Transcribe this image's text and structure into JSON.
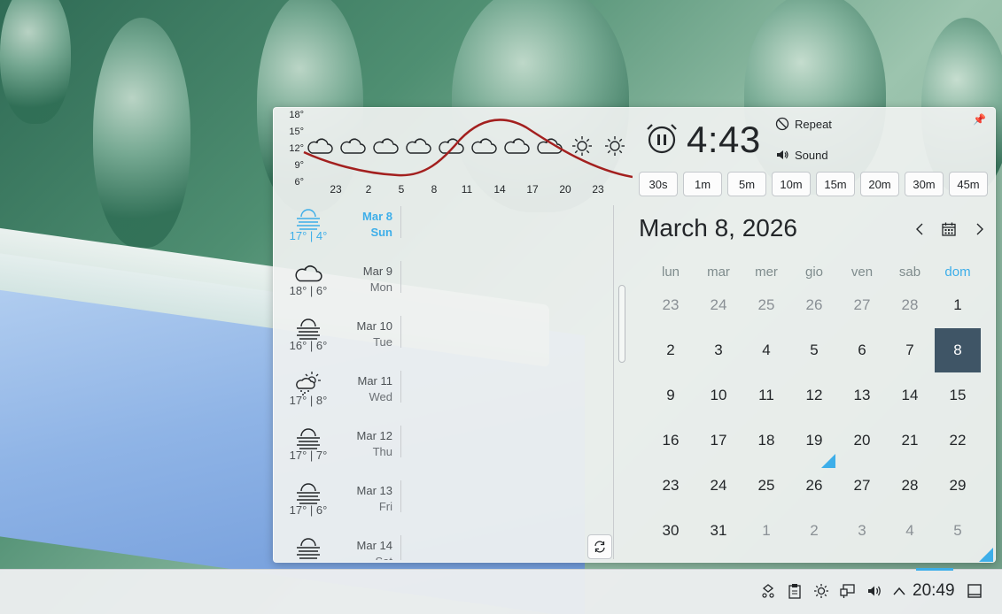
{
  "hourly": {
    "y_ticks": [
      "18°",
      "15°",
      "12°",
      "9°",
      "6°"
    ],
    "hours": [
      "23",
      "2",
      "5",
      "8",
      "11",
      "14",
      "17",
      "20",
      "23"
    ],
    "icons": [
      "cloudy-icon",
      "cloudy-icon",
      "cloudy-icon",
      "cloudy-icon",
      "cloudy-icon",
      "cloudy-icon",
      "cloudy-icon",
      "cloudy-icon",
      "sun-icon",
      "sun-icon"
    ],
    "temperature_curve_color": "#a3201f"
  },
  "timer": {
    "time": "4:43",
    "repeat_label": "Repeat",
    "sound_label": "Sound",
    "presets": [
      "30s",
      "1m",
      "5m",
      "10m",
      "15m",
      "20m",
      "30m",
      "45m"
    ]
  },
  "daily": [
    {
      "date": "Mar 8",
      "dow": "Sun",
      "temps": "17° | 4°",
      "icon": "fog-icon",
      "today": true
    },
    {
      "date": "Mar 9",
      "dow": "Mon",
      "temps": "18° | 6°",
      "icon": "cloudy-icon",
      "today": false
    },
    {
      "date": "Mar 10",
      "dow": "Tue",
      "temps": "16° | 6°",
      "icon": "fog-icon",
      "today": false
    },
    {
      "date": "Mar 11",
      "dow": "Wed",
      "temps": "17° | 8°",
      "icon": "sun-rain-icon",
      "today": false
    },
    {
      "date": "Mar 12",
      "dow": "Thu",
      "temps": "17° | 7°",
      "icon": "fog-icon",
      "today": false
    },
    {
      "date": "Mar 13",
      "dow": "Fri",
      "temps": "17° | 6°",
      "icon": "fog-icon",
      "today": false
    },
    {
      "date": "Mar 14",
      "dow": "Sat",
      "temps": "",
      "icon": "fog-icon",
      "today": false
    }
  ],
  "calendar": {
    "title": "March 8, 2026",
    "weekdays": [
      "lun",
      "mar",
      "mer",
      "gio",
      "ven",
      "sab",
      "dom"
    ],
    "weeks": [
      [
        "23",
        "24",
        "25",
        "26",
        "27",
        "28",
        "1"
      ],
      [
        "2",
        "3",
        "4",
        "5",
        "6",
        "7",
        "8"
      ],
      [
        "9",
        "10",
        "11",
        "12",
        "13",
        "14",
        "15"
      ],
      [
        "16",
        "17",
        "18",
        "19",
        "20",
        "21",
        "22"
      ],
      [
        "23",
        "24",
        "25",
        "26",
        "27",
        "28",
        "29"
      ],
      [
        "30",
        "31",
        "1",
        "2",
        "3",
        "4",
        "5"
      ]
    ],
    "accent": "#3daee9",
    "today_bg": "#3f5566"
  },
  "taskbar": {
    "clock": "20:49",
    "tray_icons": [
      "connect-icon",
      "clipboard-icon",
      "brightness-icon",
      "network-icon",
      "volume-icon",
      "chevron-up-icon",
      "show-desktop-icon"
    ]
  }
}
